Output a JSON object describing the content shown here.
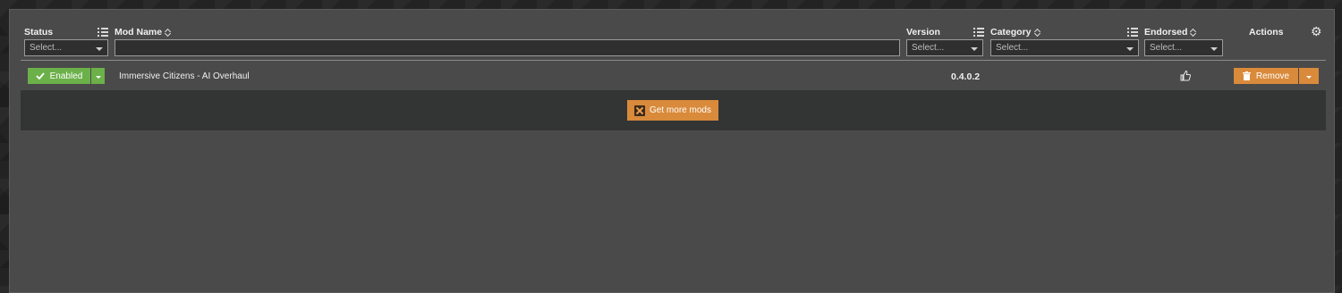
{
  "header": {
    "status": "Status",
    "mod_name": "Mod Name",
    "version": "Version",
    "category": "Category",
    "endorsed": "Endorsed",
    "actions": "Actions"
  },
  "filters": {
    "status_placeholder": "Select...",
    "version_placeholder": "Select...",
    "category_placeholder": "Select...",
    "endorsed_placeholder": "Select..."
  },
  "rows": [
    {
      "status": "Enabled",
      "name": "Immersive Citizens - AI Overhaul",
      "version": "0.4.0.2",
      "action": "Remove"
    }
  ],
  "more_mods_label": "Get more mods",
  "colors": {
    "enabled": "#6cb04a",
    "action": "#d98a3a",
    "panel": "#4a4a4a"
  }
}
